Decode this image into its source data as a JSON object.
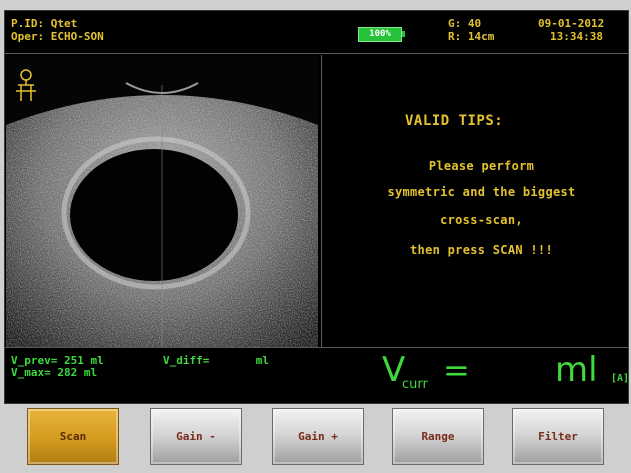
{
  "header": {
    "patient_id": "P.ID: Qtet",
    "operator": "Oper: ECHO-SON",
    "battery": "100%",
    "gain": "G: 40",
    "range": "R: 14cm",
    "date": "09-01-2012",
    "time": "13:34:38"
  },
  "tips": {
    "title": "VALID TIPS:",
    "lines": [
      "Please perform",
      "symmetric and the biggest",
      "cross-scan,",
      "then press SCAN !!!"
    ]
  },
  "volume": {
    "v_prev": "V_prev= 251 ml",
    "v_max": "V_max= 282 ml",
    "v_diff": "V_diff=       ml",
    "v_curr_label": "V",
    "v_curr_sub": "curr",
    "equals": "=",
    "unit": "ml",
    "mode": "[A]"
  },
  "buttons": {
    "scan": "Scan",
    "gain_minus": "Gain -",
    "gain_plus": "Gain +",
    "range": "Range",
    "filter": "Filter"
  },
  "colors": {
    "header_text": "#e3c230",
    "readout_green": "#3fd83f",
    "scan_button": "#d39a1e",
    "battery": "#25c23a"
  },
  "icons": {
    "body_marker": "body-position-icon"
  }
}
